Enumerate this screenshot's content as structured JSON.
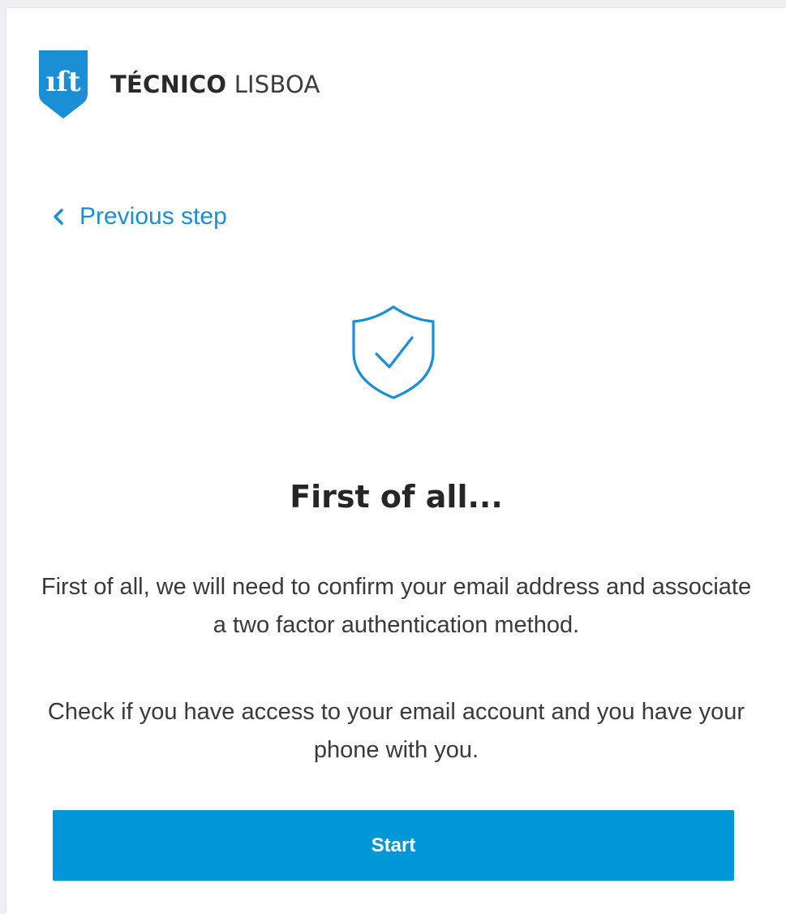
{
  "brand": {
    "name_bold": "TÉCNICO",
    "name_light": " LISBOA",
    "badge_icon": "ist-shield-logo",
    "badge_color": "#1a8fd6"
  },
  "navigation": {
    "previous_step_label": "Previous step",
    "previous_icon": "chevron-left-icon",
    "link_color": "#1a8fd6"
  },
  "main": {
    "status_icon": "shield-check-icon",
    "title": "First of all...",
    "paragraph_1": "First of all, we will need to confirm your email address and associate a two factor authentication method.",
    "paragraph_2": "Check if you have access to your email account and you have your phone with you."
  },
  "actions": {
    "start_label": "Start",
    "start_color": "#0097d8"
  }
}
